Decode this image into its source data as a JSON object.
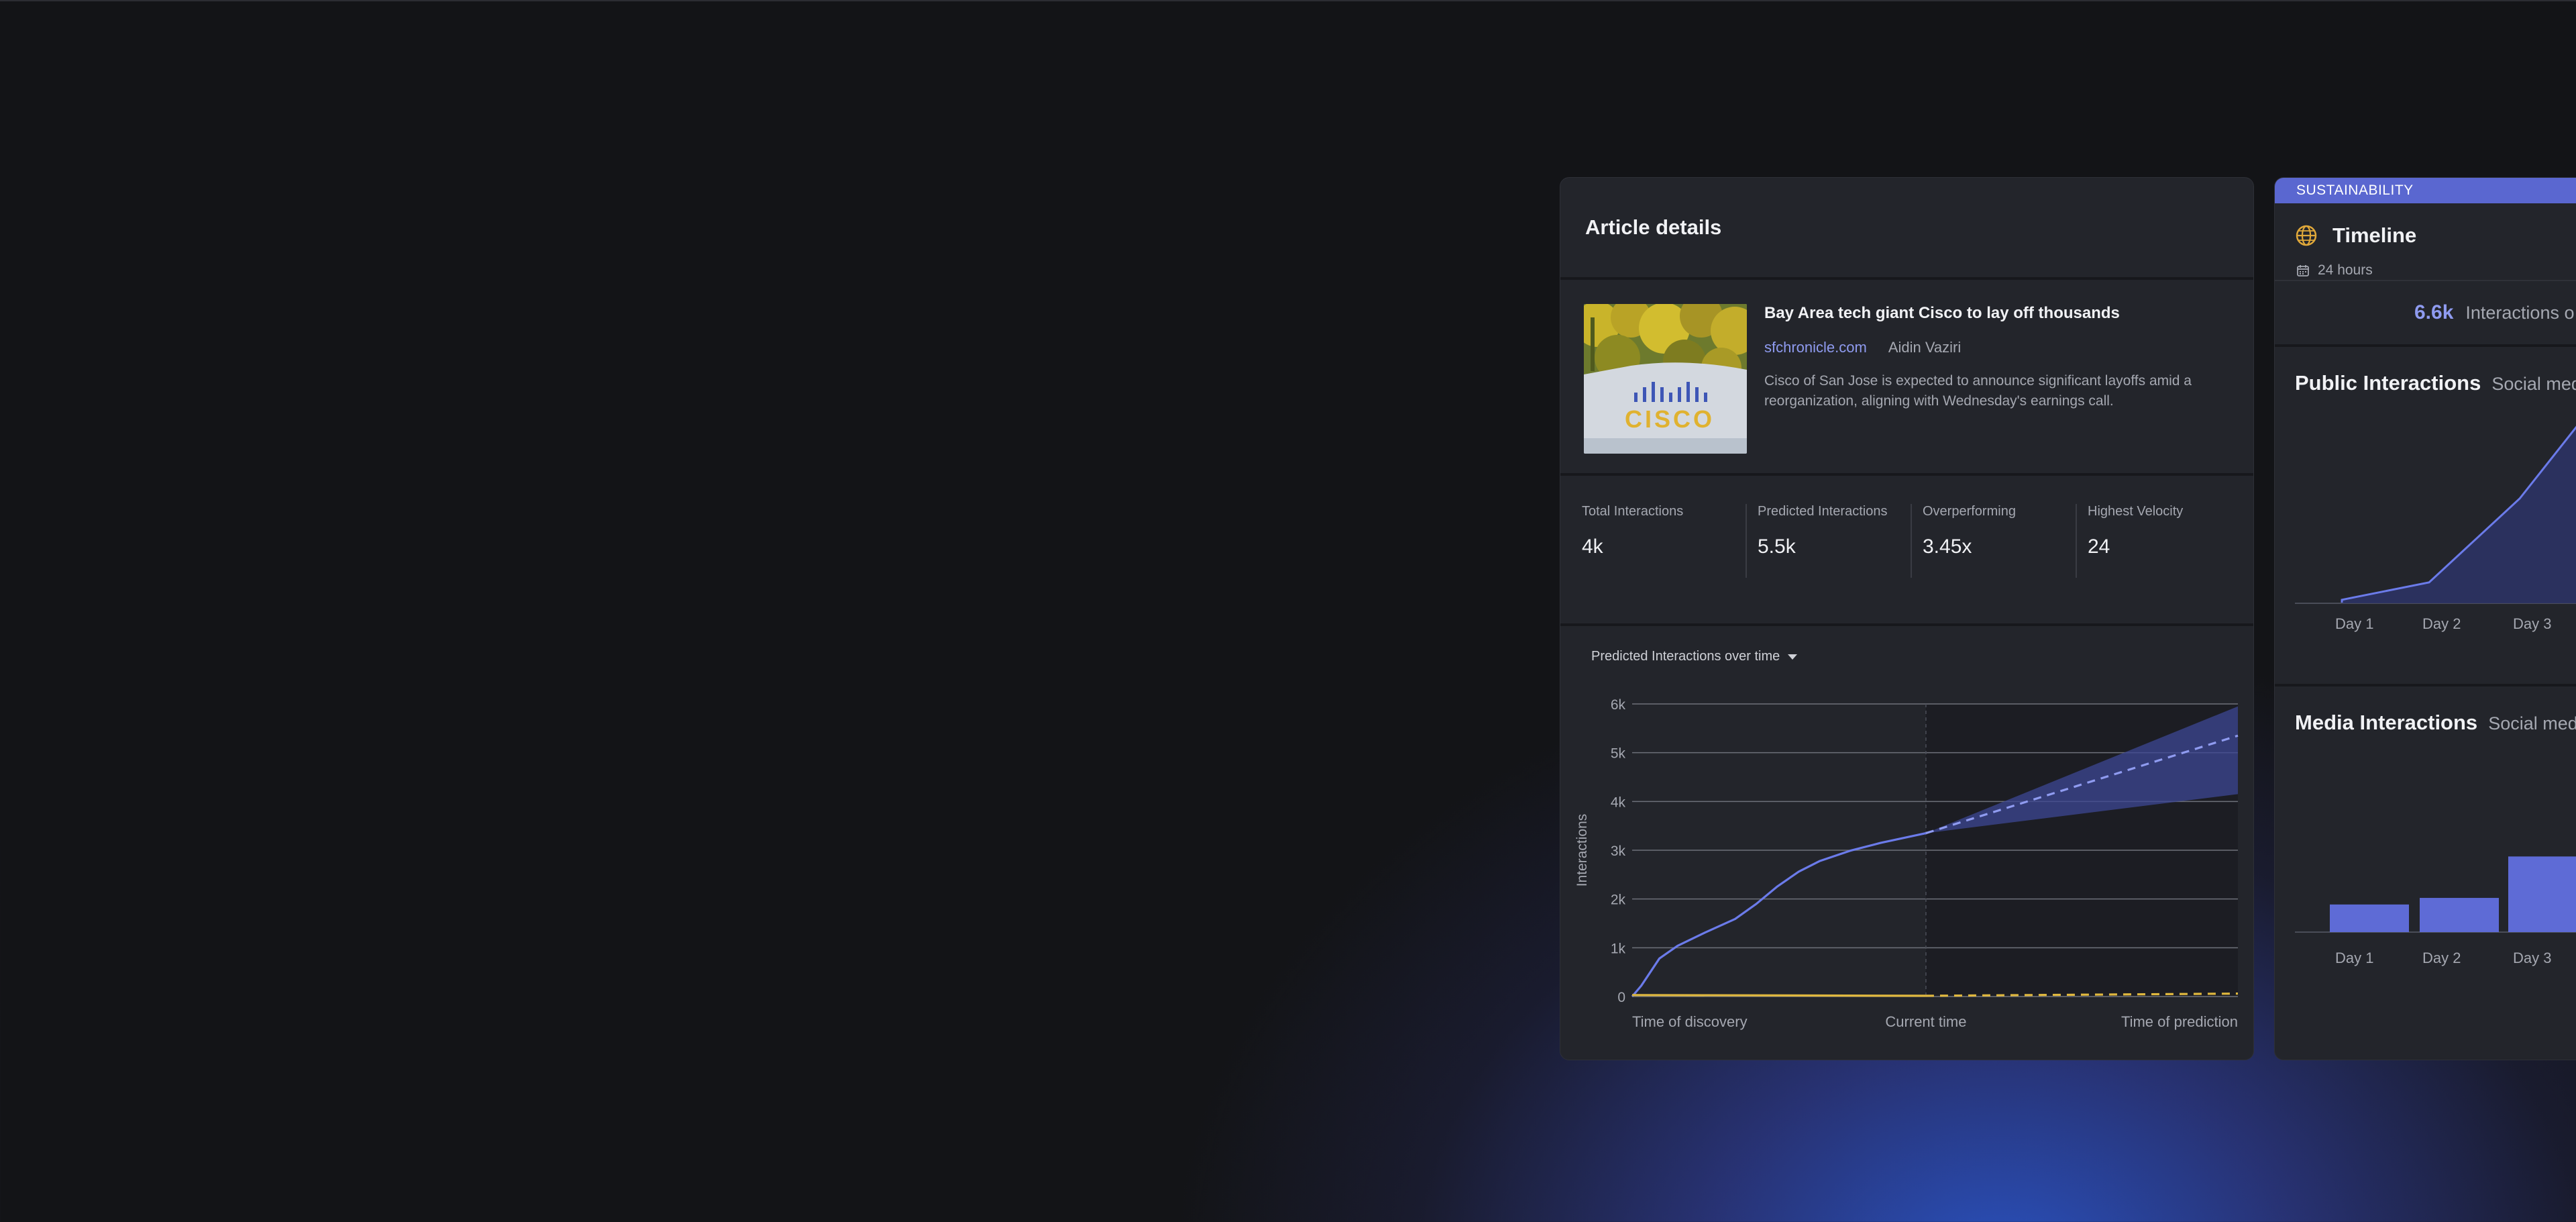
{
  "article_card": {
    "title": "Article details",
    "article": {
      "title": "Bay Area tech giant Cisco to lay off thousands",
      "source": "sfchronicle.com",
      "author": "Aidin Vaziri",
      "description": "Cisco of San Jose is expected to announce significant layoffs amid a reorganization, aligning with Wednesday's earnings call.",
      "image_logo_text": "CISCO"
    },
    "stats": [
      {
        "label": "Total Interactions",
        "value": "4k"
      },
      {
        "label": "Predicted Interactions",
        "value": "5.5k"
      },
      {
        "label": "Overperforming",
        "value": "3.45x"
      },
      {
        "label": "Highest Velocity",
        "value": "24"
      }
    ],
    "chart_selector": "Predicted Interactions over time"
  },
  "chart_data": [
    {
      "type": "line",
      "ylabel": "Interactions",
      "y_ticks": [
        "0",
        "1k",
        "2k",
        "3k",
        "4k",
        "5k",
        "6k"
      ],
      "ylim": [
        0,
        6000
      ],
      "x_tick_labels": [
        "Time of discovery",
        "Current time",
        "Time of prediction"
      ],
      "xlim": [
        0,
        1
      ],
      "current_time_x": 0.485,
      "grid": true,
      "series": [
        {
          "values_x": [
            0,
            0.015,
            0.045,
            0.075,
            0.12,
            0.17,
            0.205,
            0.24,
            0.275,
            0.31,
            0.36,
            0.41,
            0.485
          ],
          "values_y": [
            0,
            220,
            780,
            1040,
            1310,
            1590,
            1900,
            2260,
            2560,
            2780,
            2990,
            3150,
            3350
          ],
          "color": "#6b7bea"
        },
        {
          "values_x": [
            0.485,
            1.0
          ],
          "values_y": [
            3350,
            5350
          ],
          "dashed": true,
          "color": "#8f9bf0"
        },
        {
          "values_x": [
            0,
            0.485
          ],
          "values_y": [
            30,
            15
          ],
          "color": "#e0b83e"
        },
        {
          "values_x": [
            0.485,
            1.0
          ],
          "values_y": [
            15,
            60
          ],
          "dashed": true,
          "color": "#e0b83e"
        }
      ],
      "band_upper": {
        "x": [
          0.485,
          1.0
        ],
        "y": [
          3350,
          5950
        ]
      },
      "band_lower": {
        "x": [
          0.485,
          1.0
        ],
        "y": [
          3350,
          4150
        ]
      },
      "colors": {
        "line": "#6b7bea",
        "band": "#3c4794",
        "baseline": "#e0b83e"
      }
    },
    {
      "type": "area",
      "title": "Public Interactions",
      "subtitle": "Social med",
      "categories": [
        "Day 1",
        "Day 2",
        "Day 3"
      ],
      "values": [
        20,
        120,
        600
      ],
      "color": "#6b7bea"
    },
    {
      "type": "bar",
      "title": "Media Interactions",
      "subtitle": "Social med",
      "categories": [
        "Day 1",
        "Day 2",
        "Day 3"
      ],
      "values": [
        42,
        52,
        115
      ],
      "color": "#5e6bd6"
    }
  ],
  "timeline_card": {
    "tag": "SUSTAINABILITY",
    "title": "Timeline",
    "range": "24 hours",
    "summary_value": "6.6k",
    "summary_label": "Interactions o",
    "public_title": "Public Interactions",
    "public_subtitle": "Social med",
    "media_title": "Media Interactions",
    "media_subtitle": "Social med",
    "days": [
      "Day 1",
      "Day 2",
      "Day 3"
    ]
  }
}
